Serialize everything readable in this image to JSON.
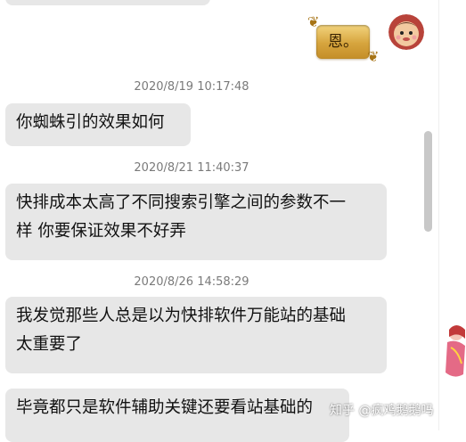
{
  "conversation": {
    "sent_message": "恩。",
    "entries": [
      {
        "timestamp": "2020/8/19 10:17:48",
        "message": "你蜘蛛引的效果如何"
      },
      {
        "timestamp": "2020/8/21 11:40:37",
        "message_line1": "快排成本太高了不同搜索引擎之间的参数不一",
        "message_line2": "样 你要保证效果不好弄"
      },
      {
        "timestamp": "2020/8/26 14:58:29",
        "message_line1": "我发觉那些人总是以为快排软件万能站的基础",
        "message_line2": "太重要了"
      }
    ],
    "last_message": "毕竟都只是软件辅助关键还要看站基础的"
  },
  "watermark": "知乎 @疯鸡鹅鹅吗",
  "icons": {
    "gold_bubble_decor": "bubble-decoration-icon",
    "avatar": "user-avatar-icon",
    "side_decoration": "sticker-decoration-icon"
  },
  "colors": {
    "bubble_bg": "#e7e7e7",
    "timestamp_text": "#7a7a7a",
    "gold_bubble": "#d6a43d"
  }
}
